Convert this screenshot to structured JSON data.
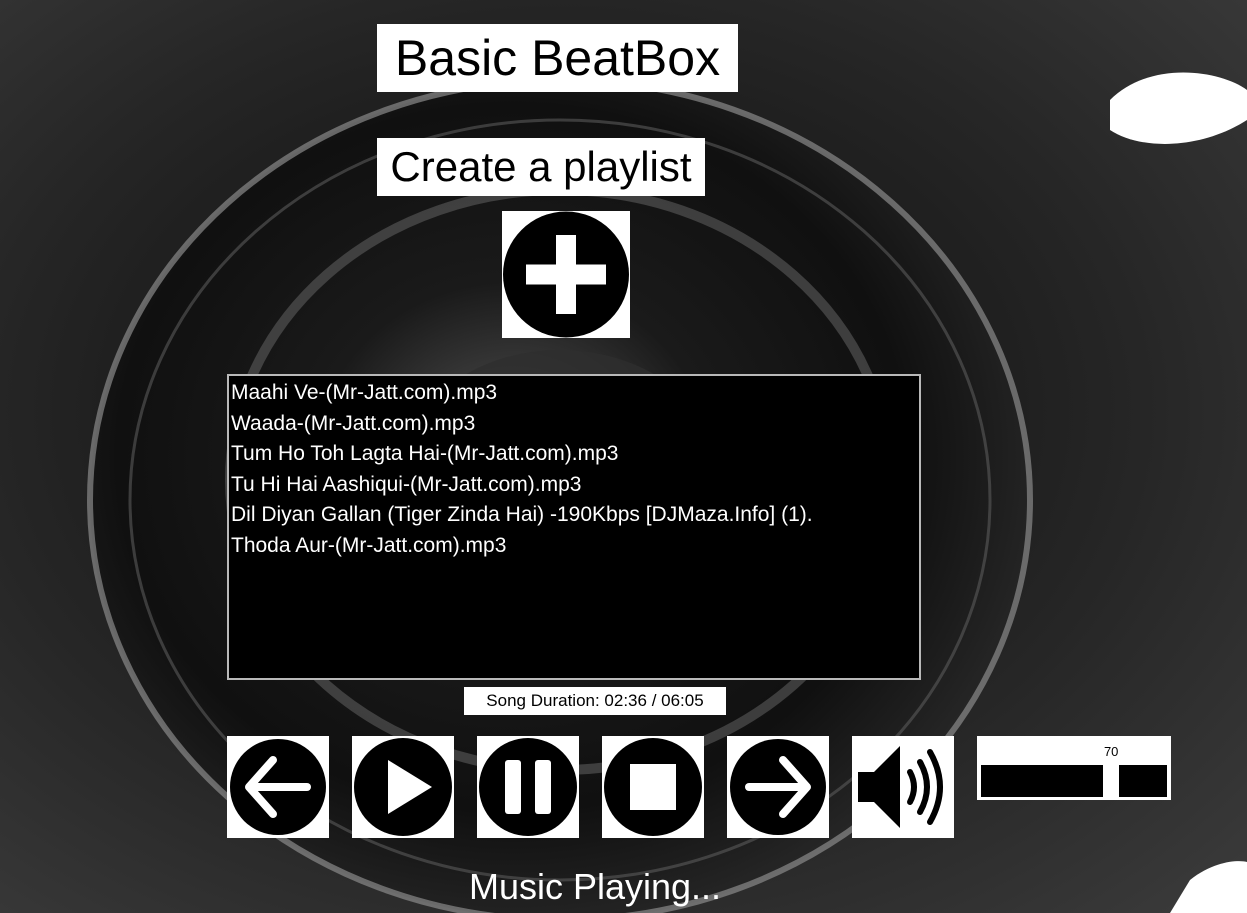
{
  "app": {
    "title": "Basic BeatBox",
    "create_playlist_label": "Create a playlist"
  },
  "playlist": {
    "items": [
      "Maahi Ve-(Mr-Jatt.com).mp3",
      "Waada-(Mr-Jatt.com).mp3",
      "Tum Ho Toh Lagta Hai-(Mr-Jatt.com).mp3",
      "Tu Hi Hai Aashiqui-(Mr-Jatt.com).mp3",
      "Dil Diyan Gallan (Tiger Zinda Hai) -190Kbps [DJMaza.Info] (1).",
      "Thoda Aur-(Mr-Jatt.com).mp3"
    ]
  },
  "duration": {
    "text": "Song Duration:  02:36 / 06:05"
  },
  "controls": [
    {
      "name": "previous-button",
      "icon": "arrow-left-icon"
    },
    {
      "name": "play-button",
      "icon": "play-icon"
    },
    {
      "name": "pause-button",
      "icon": "pause-icon"
    },
    {
      "name": "stop-button",
      "icon": "stop-icon"
    },
    {
      "name": "next-button",
      "icon": "arrow-right-icon"
    },
    {
      "name": "mute-button",
      "icon": "speaker-icon"
    }
  ],
  "volume": {
    "value": 70,
    "label": "70"
  },
  "status": {
    "text": "Music Playing..."
  },
  "colors": {
    "background": "#262626",
    "panel": "#ffffff",
    "icon": "#000000",
    "playlist_background": "#000000",
    "playlist_text": "#ffffff"
  }
}
